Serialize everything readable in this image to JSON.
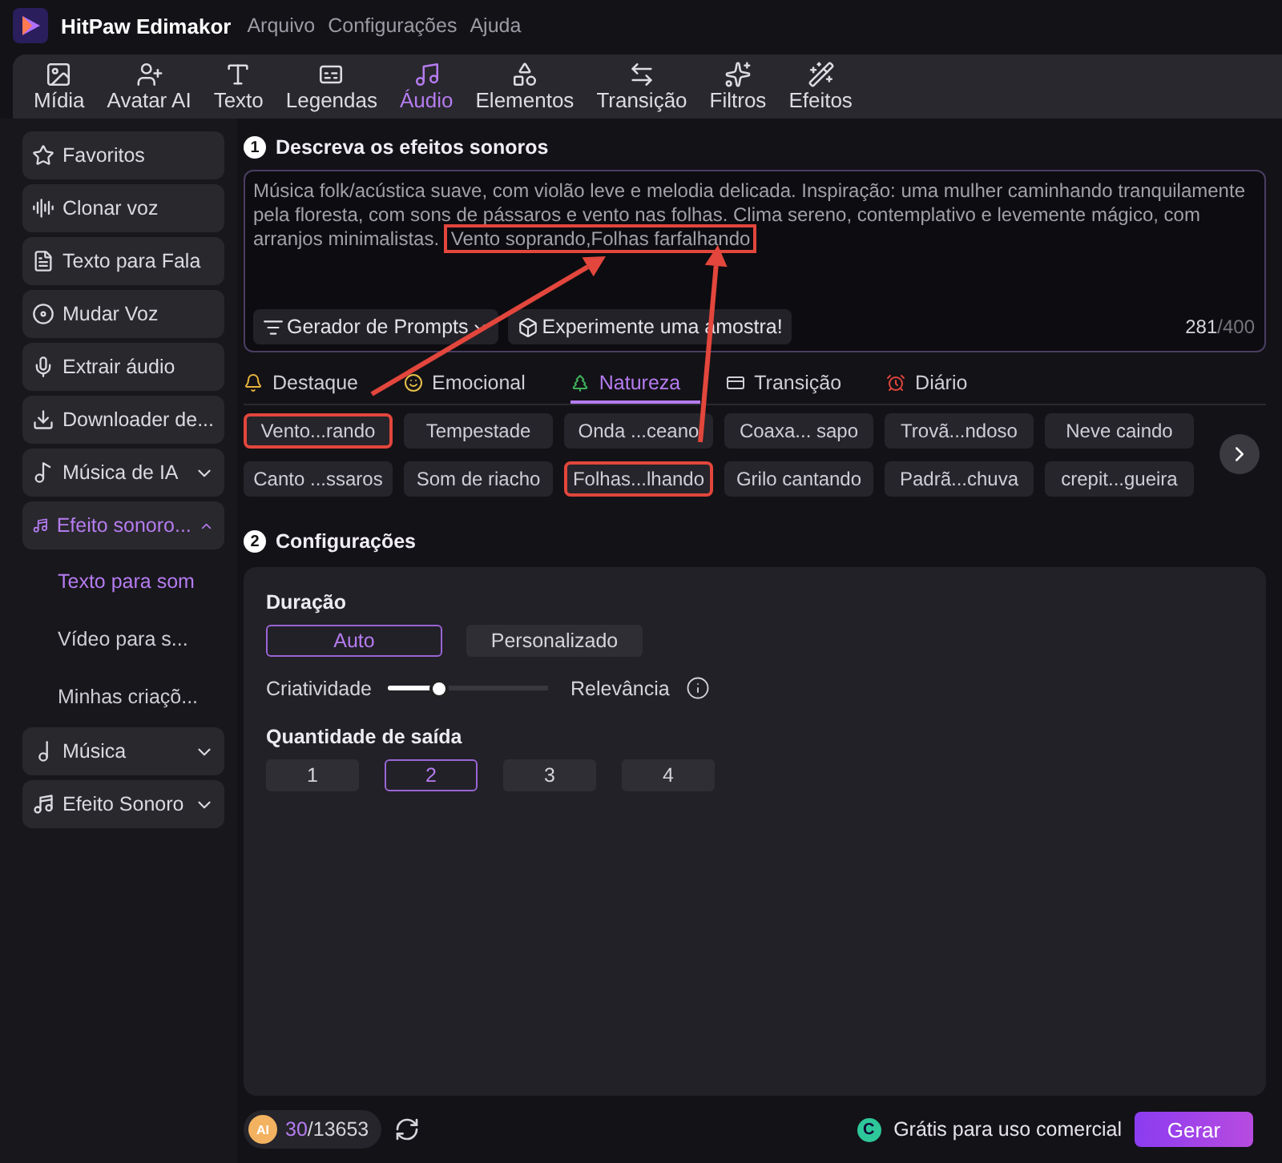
{
  "app": {
    "title": "HitPaw Edimakor",
    "menu": [
      "Arquivo",
      "Configurações",
      "Ajuda"
    ]
  },
  "toolbar": [
    {
      "label": "Mídia",
      "selected": false
    },
    {
      "label": "Avatar AI",
      "selected": false
    },
    {
      "label": "Texto",
      "selected": false
    },
    {
      "label": "Legendas",
      "selected": false
    },
    {
      "label": "Áudio",
      "selected": true
    },
    {
      "label": "Elementos",
      "selected": false
    },
    {
      "label": "Transição",
      "selected": false
    },
    {
      "label": "Filtros",
      "selected": false
    },
    {
      "label": "Efeitos",
      "selected": false
    }
  ],
  "sidebar": [
    {
      "label": "Favoritos",
      "kind": "link",
      "selected": false
    },
    {
      "label": "Clonar voz",
      "kind": "link",
      "selected": false
    },
    {
      "label": "Texto para Fala",
      "kind": "link",
      "selected": false
    },
    {
      "label": "Mudar Voz",
      "kind": "link",
      "selected": false
    },
    {
      "label": "Extrair áudio",
      "kind": "link",
      "selected": false
    },
    {
      "label": "Downloader de...",
      "kind": "link",
      "selected": false
    },
    {
      "label": "Música de IA",
      "kind": "group",
      "selected": false,
      "expanded": false
    },
    {
      "label": "Efeito sonoro...",
      "kind": "group",
      "selected": true,
      "expanded": true,
      "children": [
        {
          "label": "Texto para som",
          "selected": true
        },
        {
          "label": "Vídeo para s...",
          "selected": false
        },
        {
          "label": "Minhas criaçõ...",
          "selected": false
        }
      ]
    },
    {
      "label": "Música",
      "kind": "group",
      "selected": false,
      "expanded": false
    },
    {
      "label": "Efeito Sonoro",
      "kind": "group",
      "selected": false,
      "expanded": false
    }
  ],
  "describe": {
    "step": "1",
    "title": "Descreva os efeitos sonoros",
    "prompt": "Música folk/acústica suave, com violão leve e melodia delicada. Inspiração: uma mulher caminhando tranquilamente pela floresta, com sons de pássaros e vento nas folhas. Clima sereno, contemplativo e levemente mágico, com arranjos minimalistas.",
    "prompt_highlight": "Vento soprando,Folhas farfalhando",
    "prompt_generator": "Gerador de Prompts",
    "sample": "Experimente uma amostra!",
    "count": "281",
    "limit": "/400"
  },
  "categories": [
    {
      "label": "Destaque",
      "selected": false
    },
    {
      "label": "Emocional",
      "selected": false
    },
    {
      "label": "Natureza",
      "selected": true
    },
    {
      "label": "Transição",
      "selected": false
    },
    {
      "label": "Diário",
      "selected": false
    }
  ],
  "chip_rows": [
    [
      {
        "label": "Vento...rando",
        "highlighted": true
      },
      {
        "label": "Tempestade",
        "highlighted": false
      },
      {
        "label": "Onda ...ceano",
        "highlighted": false
      },
      {
        "label": "Coaxa... sapo",
        "highlighted": false
      },
      {
        "label": "Trovã...ndoso",
        "highlighted": false
      },
      {
        "label": "Neve caindo",
        "highlighted": false
      }
    ],
    [
      {
        "label": "Canto ...ssaros",
        "highlighted": false
      },
      {
        "label": "Som de riacho",
        "highlighted": false
      },
      {
        "label": "Folhas...lhando",
        "highlighted": true
      },
      {
        "label": "Grilo cantando",
        "highlighted": false
      },
      {
        "label": "Padrã...chuva",
        "highlighted": false
      },
      {
        "label": "crepit...gueira",
        "highlighted": false
      }
    ]
  ],
  "settings": {
    "step": "2",
    "title": "Configurações",
    "duration_label": "Duração",
    "duration_options": [
      {
        "label": "Auto",
        "selected": true
      },
      {
        "label": "Personalizado",
        "selected": false
      }
    ],
    "slider": {
      "left_label": "Criatividade",
      "right_label": "Relevância",
      "level": 0.32
    },
    "output_label": "Quantidade de saída",
    "output_options": [
      {
        "label": "1",
        "selected": false
      },
      {
        "label": "2",
        "selected": true
      },
      {
        "label": "3",
        "selected": false
      },
      {
        "label": "4",
        "selected": false
      }
    ]
  },
  "footer": {
    "coin": "AI",
    "credits_used": "30",
    "credits_total": "/13653",
    "license_icon": "C",
    "license": "Grátis para uso comercial",
    "generate": "Gerar"
  }
}
